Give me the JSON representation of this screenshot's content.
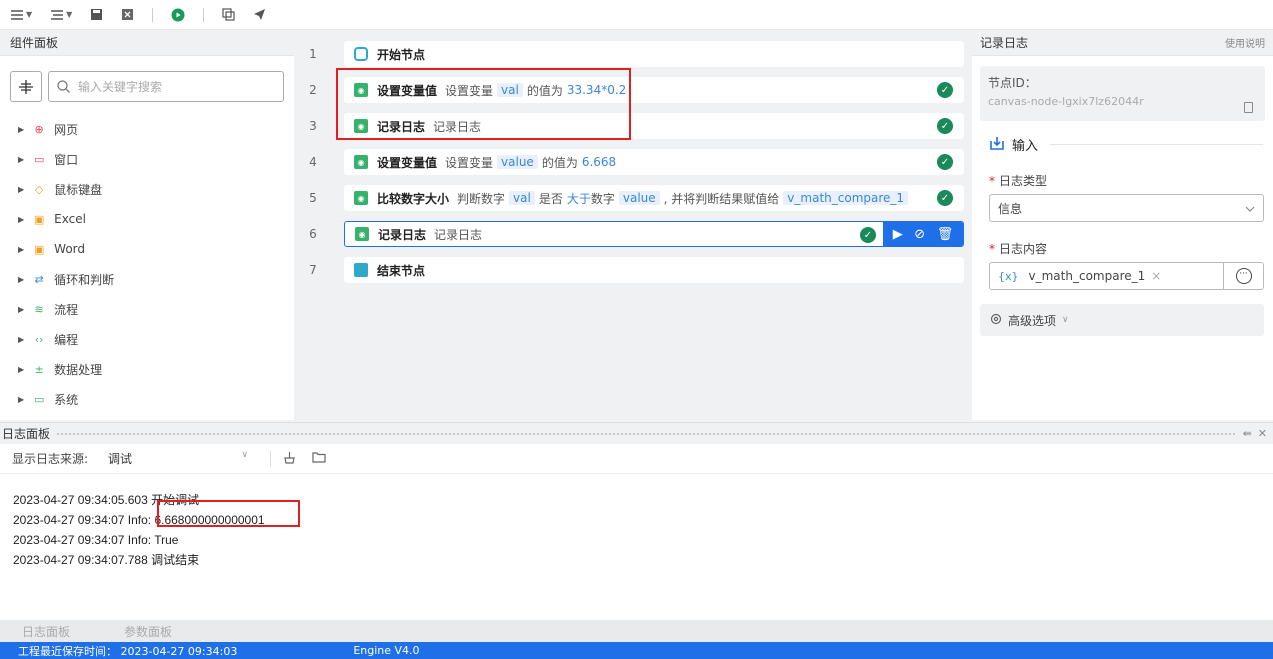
{
  "toolbar": {
    "items": [
      "layers-a-icon",
      "layers-b-icon",
      "save-icon",
      "close-box-icon",
      "run-icon",
      "copy-icon",
      "send-icon"
    ]
  },
  "left_panel": {
    "title": "组件面板",
    "search_placeholder": "输入关键字搜索",
    "tree": [
      {
        "label": "网页",
        "icon": "globe-icon",
        "color": "#e24a4a"
      },
      {
        "label": "窗口",
        "icon": "window-icon",
        "color": "#e24a4a"
      },
      {
        "label": "鼠标键盘",
        "icon": "mouse-icon",
        "color": "#f0a020"
      },
      {
        "label": "Excel",
        "icon": "excel-icon",
        "color": "#f0a020"
      },
      {
        "label": "Word",
        "icon": "word-icon",
        "color": "#f0a020"
      },
      {
        "label": "循环和判断",
        "icon": "loop-icon",
        "color": "#3a86d6"
      },
      {
        "label": "流程",
        "icon": "flow-icon",
        "color": "#37b26c"
      },
      {
        "label": "编程",
        "icon": "code-icon",
        "color": "#37b26c"
      },
      {
        "label": "数据处理",
        "icon": "data-icon",
        "color": "#37b26c"
      },
      {
        "label": "系统",
        "icon": "monitor-icon",
        "color": "#37b26c"
      }
    ]
  },
  "canvas": {
    "nodes": [
      {
        "num": "1",
        "title": "开始节点",
        "kind": "start"
      },
      {
        "num": "2",
        "title": "设置变量值",
        "desc1": "设置变量",
        "tag1": "val",
        "desc2": "的值为",
        "value": "33.34*0.2",
        "check": true
      },
      {
        "num": "3",
        "title": "记录日志",
        "desc1": "记录日志",
        "check": true
      },
      {
        "num": "4",
        "title": "设置变量值",
        "desc1": "设置变量",
        "tag1": "value",
        "desc2": "的值为",
        "value": "6.668",
        "check": true
      },
      {
        "num": "5",
        "title": "比较数字大小",
        "desc1": "判断数字",
        "tag1": "val",
        "desc2": "是否",
        "op": "大于",
        "desc3": "数字",
        "tag2": "value",
        "desc4": ", 并将判断结果赋值给",
        "tag3": "v_math_compare_1",
        "check": true
      },
      {
        "num": "6",
        "title": "记录日志",
        "desc1": "记录日志",
        "check": true,
        "selected": true
      },
      {
        "num": "7",
        "title": "结束节点",
        "kind": "end"
      }
    ]
  },
  "right_panel": {
    "title": "记录日志",
    "help": "使用说明",
    "node_id_label": "节点ID：",
    "node_id_value": "canvas-node-lgxix7lz62044r",
    "input_section": "输入",
    "log_type_label": "日志类型",
    "log_type_value": "信息",
    "log_content_label": "日志内容",
    "log_content_fx": "{x}",
    "log_content_value": "v_math_compare_1",
    "advanced": "高级选项"
  },
  "log_panel": {
    "title": "日志面板",
    "source_label": "显示日志来源:",
    "source_value": "调试",
    "lines": [
      "2023-04-27 09:34:05.603 开始调试",
      "2023-04-27 09:34:07 Info: 6.668000000000001",
      "2023-04-27 09:34:07 Info: True",
      "2023-04-27 09:34:07.788 调试结束"
    ],
    "tabs": [
      "日志面板",
      "参数面板"
    ]
  },
  "status_bar": {
    "saved": "工程最近保存时间：  2023-04-27 09:34:03",
    "engine": "Engine V4.0"
  },
  "colors": {
    "accent": "#1e6fe8",
    "success": "#1a8a5a",
    "highlight": "#e02020"
  }
}
